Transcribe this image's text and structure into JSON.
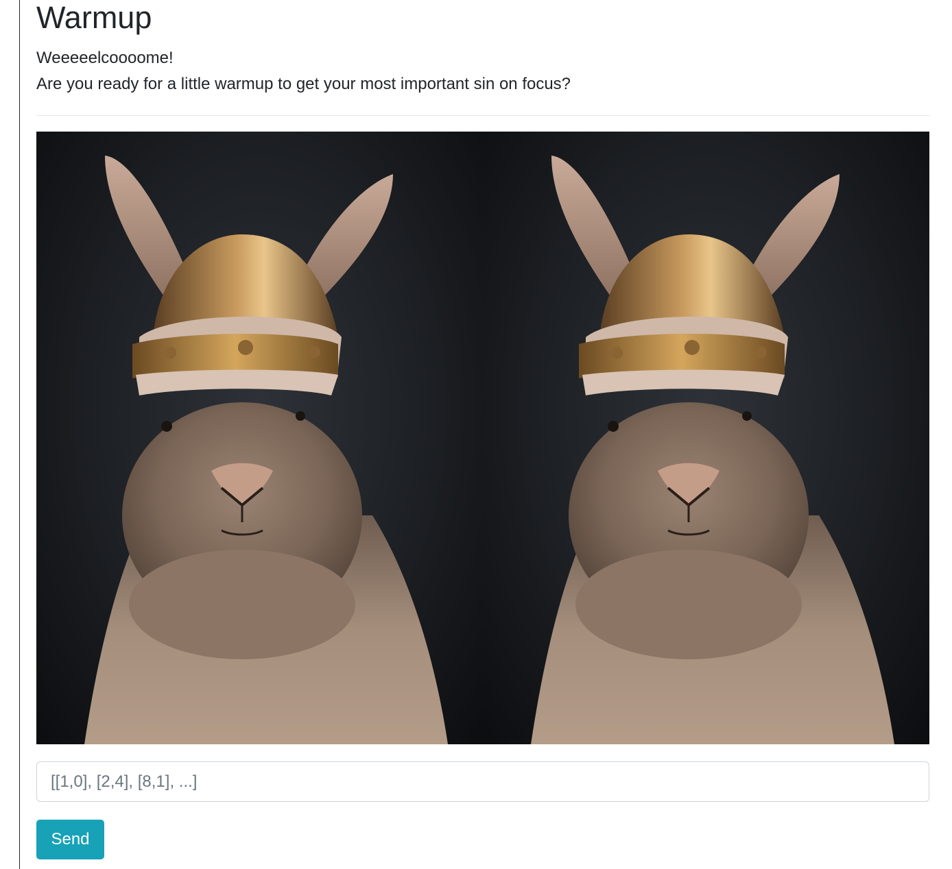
{
  "page": {
    "title": "Warmup",
    "intro_line1": "Weeeeelcoooome!",
    "intro_line2": "Are you ready for a little warmup to get your most important sin on focus?"
  },
  "puzzle": {
    "image_left": "rabbit-viking-helmet-photo",
    "image_right": "rabbit-viking-helmet-photo"
  },
  "form": {
    "answer_placeholder": "[[1,0], [2,4], [8,1], ...]",
    "answer_value": "",
    "send_label": "Send"
  },
  "colors": {
    "accent": "#17a2b8",
    "text": "#212529",
    "photo_background": "#1c1f23"
  }
}
